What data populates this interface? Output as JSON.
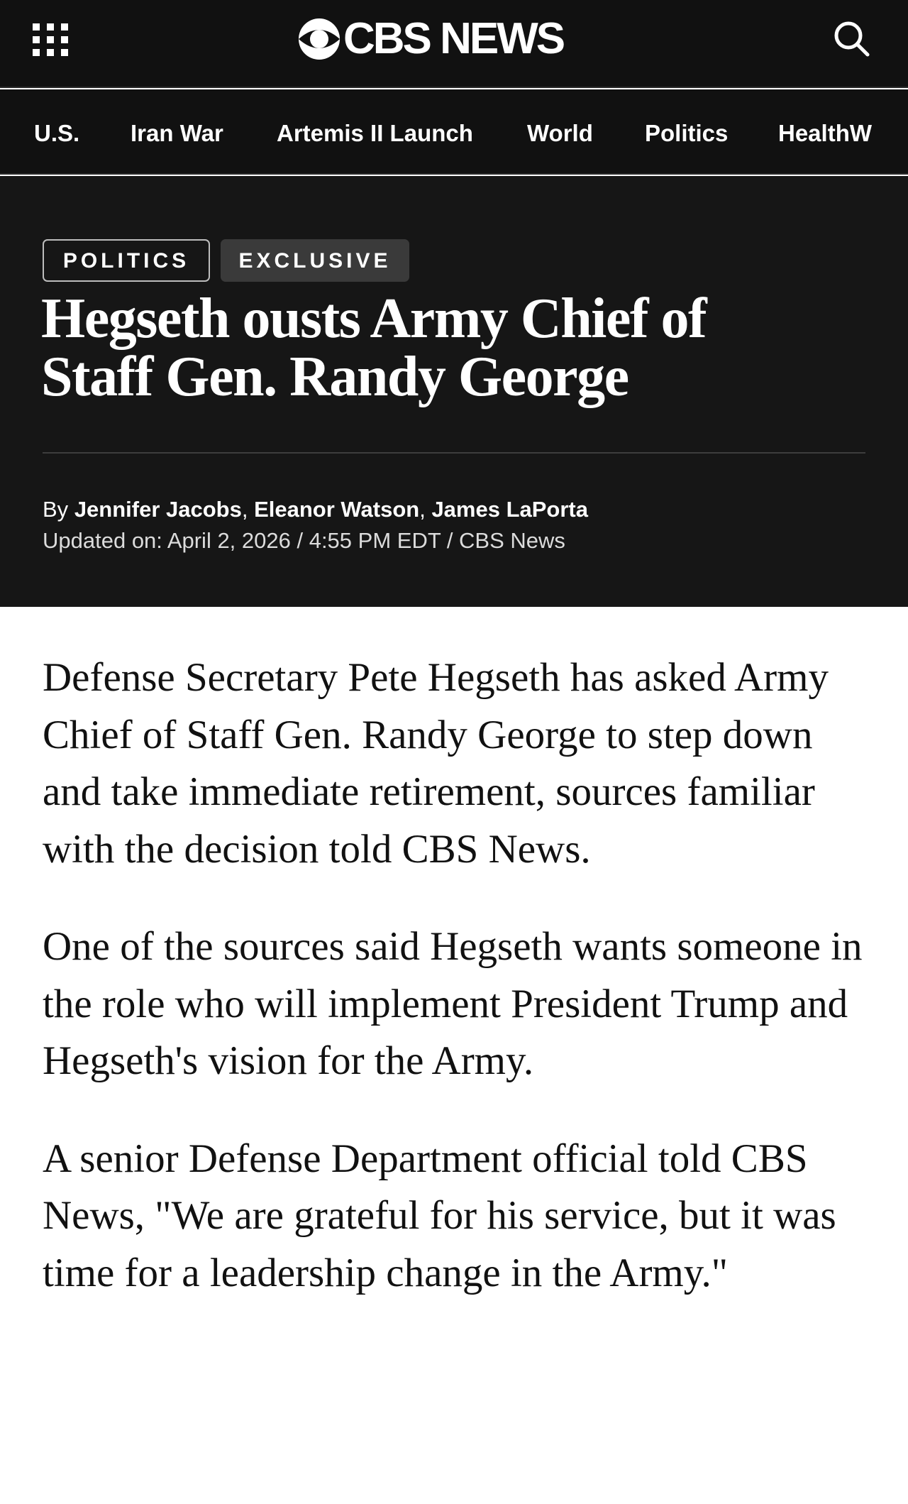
{
  "header": {
    "logo_text": "CBS NEWS",
    "menu_icon": "grid-menu-icon",
    "search_icon": "search-icon"
  },
  "nav": {
    "items": [
      "U.S.",
      "Iran War",
      "Artemis II Launch",
      "World",
      "Politics",
      "HealthW"
    ]
  },
  "article": {
    "tags": [
      "POLITICS",
      "EXCLUSIVE"
    ],
    "headline_line1": "Hegseth ousts Army Chief of",
    "headline_line2": "Staff Gen. Randy George",
    "byline_prefix": "By",
    "authors": [
      "Jennifer Jacobs",
      "Eleanor Watson",
      "James LaPorta"
    ],
    "updated": "Updated on: April 2, 2026 / 4:55 PM EDT / CBS News",
    "paragraphs": [
      "Defense Secretary Pete Hegseth has asked Army Chief of Staff Gen. Randy George to step down and take immediate retirement, sources familiar with the decision told CBS News.",
      "One of the sources said Hegseth wants someone in the role who will implement President Trump and Hegseth's vision for the Army.",
      "A senior Defense Department official told CBS News, \"We are grateful for his service, but it was time for a leadership change in the Army.\""
    ]
  },
  "colors": {
    "header_bg": "#111111",
    "hero_bg": "#161616",
    "tag_exclusive_bg": "#3a3a3a",
    "text_dark": "#111111",
    "text_light": "#ffffff"
  }
}
